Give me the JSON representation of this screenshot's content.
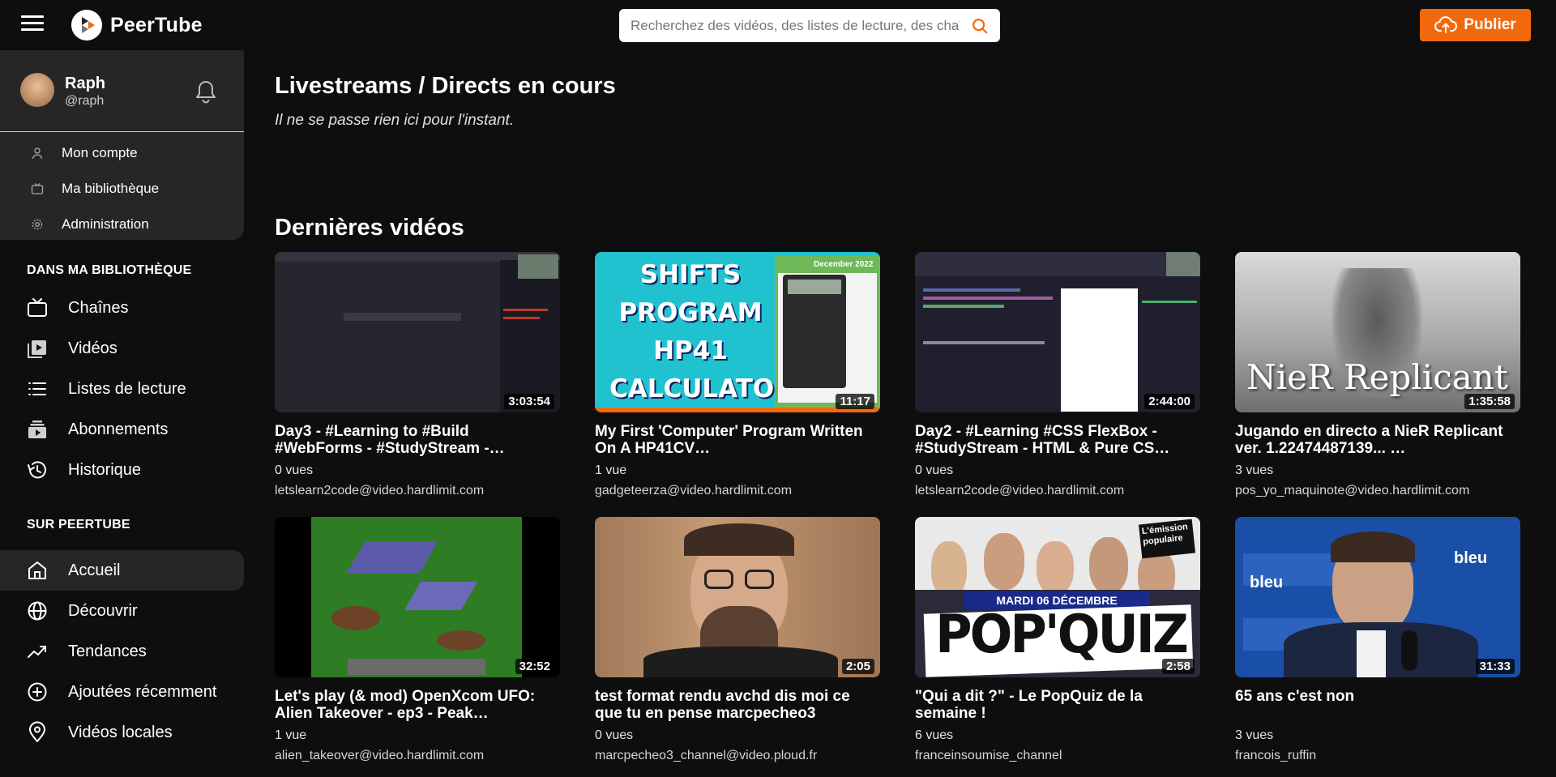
{
  "app": {
    "name": "PeerTube"
  },
  "search": {
    "placeholder": "Recherchez des vidéos, des listes de lecture, des chaînes…"
  },
  "header": {
    "publish_label": "Publier"
  },
  "user": {
    "name": "Raph",
    "handle": "@raph",
    "menu": [
      "Mon compte",
      "Ma bibliothèque",
      "Administration"
    ]
  },
  "sidebar": {
    "library_title": "DANS MA BIBLIOTHÈQUE",
    "library_items": [
      {
        "label": "Chaînes",
        "icon": "tv-icon"
      },
      {
        "label": "Vidéos",
        "icon": "videos-icon"
      },
      {
        "label": "Listes de lecture",
        "icon": "playlist-icon"
      },
      {
        "label": "Abonnements",
        "icon": "subscriptions-icon"
      },
      {
        "label": "Historique",
        "icon": "history-icon"
      }
    ],
    "peertube_title": "SUR PEERTUBE",
    "peertube_items": [
      {
        "label": "Accueil",
        "icon": "home-icon",
        "active": true
      },
      {
        "label": "Découvrir",
        "icon": "globe-icon"
      },
      {
        "label": "Tendances",
        "icon": "trending-icon"
      },
      {
        "label": "Ajoutées récemment",
        "icon": "plus-circle-icon"
      },
      {
        "label": "Vidéos locales",
        "icon": "location-icon"
      }
    ]
  },
  "main": {
    "live_title": "Livestreams / Directs en cours",
    "live_empty": "Il ne se passe rien ici pour l'instant.",
    "latest_title": "Dernières vidéos",
    "videos": [
      {
        "title": "Day3 - #Learning to #Build #WebForms - #StudyStream -…",
        "duration": "3:03:54",
        "views": "0 vues",
        "channel": "letslearn2code@video.hardlimit.com"
      },
      {
        "title": "My First 'Computer' Program Written On A HP41CV…",
        "duration": "11:17",
        "views": "1 vue",
        "channel": "gadgeteerza@video.hardlimit.com",
        "thumb_text": [
          "SHIFTS",
          "PROGRAM",
          "HP41",
          "CALCULATOR"
        ],
        "thumb_tag": "December 2022"
      },
      {
        "title": "Day2 - #Learning #CSS FlexBox - #StudyStream - HTML & Pure CS…",
        "duration": "2:44:00",
        "views": "0 vues",
        "channel": "letslearn2code@video.hardlimit.com"
      },
      {
        "title": "Jugando en directo a NieR Replicant ver. 1.22474487139... …",
        "duration": "1:35:58",
        "views": "3 vues",
        "channel": "pos_yo_maquinote@video.hardlimit.com",
        "thumb_text": "NieR Replicant"
      },
      {
        "title": "Let's play (& mod) OpenXcom UFO: Alien Takeover - ep3 - Peak…",
        "duration": "32:52",
        "views": "1 vue",
        "channel": "alien_takeover@video.hardlimit.com"
      },
      {
        "title": "test format rendu avchd dis moi ce que tu en pense marcpecheo3",
        "duration": "2:05",
        "views": "0 vues",
        "channel": "marcpecheo3_channel@video.ploud.fr"
      },
      {
        "title": "\"Qui a dit ?\" - Le PopQuiz de la semaine !",
        "duration": "2:58",
        "views": "6 vues",
        "channel": "franceinsoumise_channel",
        "thumb_text": "POP'QUIZ",
        "thumb_tag": "MARDI 06 DÉCEMBRE",
        "thumb_badge": "L'émission populaire"
      },
      {
        "title": "65 ans c'est non",
        "duration": "31:33",
        "views": "3 vues",
        "channel": "francois_ruffin",
        "thumb_text": "bleu"
      }
    ]
  },
  "colors": {
    "accent": "#f2690d",
    "panel": "#262626",
    "background": "#0e0e0e"
  }
}
